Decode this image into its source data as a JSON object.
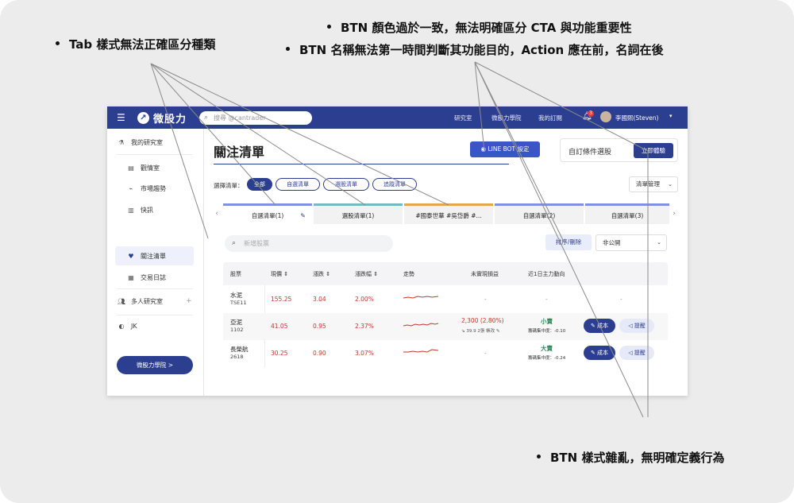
{
  "annotations": {
    "tab_style": "Tab 樣式無法正確區分種類",
    "btn_color": "BTN 顏色過於一致，無法明確區分 CTA 與功能重要性",
    "btn_name": "BTN 名稱無法第一時間判斷其功能目的，Action 應在前，名詞在後",
    "btn_style": "BTN 樣式雜亂，無明確定義行為"
  },
  "topbar": {
    "brand": "微股力",
    "search_placeholder": "搜尋 @cantrader",
    "nav": [
      "研究室",
      "微股力學院",
      "我的訂閱"
    ],
    "bell_badge": "3",
    "user_name": "李國熙(Steven)"
  },
  "sidebar": {
    "my_lab": "我的研究室",
    "items": [
      "觀情室",
      "市場趨勢",
      "快訊",
      "關注清單",
      "交易日誌"
    ],
    "multi_lab": "多人研究室",
    "jk": "JK",
    "academy_btn": "微股力學院 >"
  },
  "main": {
    "title": "關注清單",
    "line_btn": "LINE BOT 設定",
    "custom_label": "自訂條件選股",
    "try_btn": "立即體驗",
    "filter_label": "選擇清單：",
    "chips": [
      "全部",
      "自選清單",
      "選股清單",
      "追蹤清單"
    ],
    "manage": "清單管理",
    "tabs": [
      "自選清單(1)",
      "選股清單(1)",
      "#國泰世華 #吳岱爵 #...",
      "自選清單(2)",
      "自選清單(3)"
    ],
    "list_search_placeholder": "新增股票",
    "sort_btn": "排序/刪除",
    "privacy": "非公開"
  },
  "table": {
    "headers": [
      "股票",
      "現價 ⇕",
      "漲跌 ⇕",
      "漲跌幅 ⇕",
      "走勢",
      "未實現損益",
      "近1日主力動向"
    ],
    "rows": [
      {
        "name": "水泥",
        "code": "TSE11",
        "price": "155.25",
        "change": "3.04",
        "pct": "2.00%",
        "pnl": "-",
        "flow": "-",
        "flow_sub": "",
        "pnl_sub": "",
        "actions": [],
        "tail": "-"
      },
      {
        "name": "亞泥",
        "code": "1102",
        "price": "41.05",
        "change": "0.95",
        "pct": "2.37%",
        "pnl": "2,300 (2.80%)",
        "pnl_sub": "⇘ 39.9  2張  帳改 ✎",
        "flow": "小賣",
        "flow_sub": "籌碼集中度：-0.10",
        "actions": [
          "成本",
          "提醒"
        ],
        "tail": ""
      },
      {
        "name": "長榮航",
        "code": "2618",
        "price": "30.25",
        "change": "0.90",
        "pct": "3.07%",
        "pnl": "-",
        "pnl_sub": "",
        "flow": "大賣",
        "flow_sub": "籌碼集中度：-0.24",
        "actions": [
          "成本",
          "提醒"
        ],
        "tail": ""
      }
    ]
  }
}
